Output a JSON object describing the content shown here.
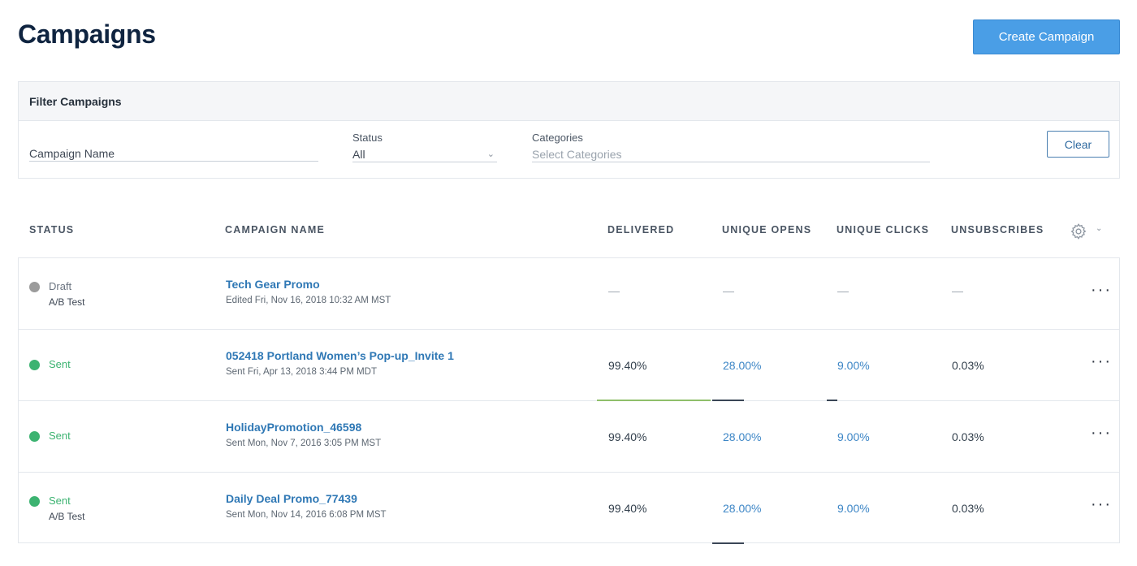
{
  "header": {
    "title": "Campaigns",
    "create_button": "Create Campaign"
  },
  "filters": {
    "title": "Filter Campaigns",
    "campaign_name_placeholder": "Campaign Name",
    "status_label": "Status",
    "status_value": "All",
    "categories_label": "Categories",
    "categories_placeholder": "Select Categories",
    "clear_button": "Clear"
  },
  "table": {
    "columns": [
      "STATUS",
      "CAMPAIGN NAME",
      "DELIVERED",
      "UNIQUE OPENS",
      "UNIQUE CLICKS",
      "UNSUBSCRIBES"
    ],
    "rows": [
      {
        "status": "Draft",
        "sub": "A/B Test",
        "name": "Tech Gear Promo",
        "meta": "Edited Fri, Nov 16, 2018 10:32 AM MST",
        "delivered": "—",
        "opens": "—",
        "clicks": "—",
        "unsubscribes": "—"
      },
      {
        "status": "Sent",
        "sub": "",
        "name": "052418 Portland Women’s Pop-up_Invite 1",
        "meta": "Sent Fri, Apr 13, 2018 3:44 PM MDT",
        "delivered": "99.40%",
        "opens": "28.00%",
        "clicks": "9.00%",
        "unsubscribes": "0.03%"
      },
      {
        "status": "Sent",
        "sub": "",
        "name": "HolidayPromotion_46598",
        "meta": "Sent Mon, Nov 7, 2016 3:05 PM MST",
        "delivered": "99.40%",
        "opens": "28.00%",
        "clicks": "9.00%",
        "unsubscribes": "0.03%"
      },
      {
        "status": "Sent",
        "sub": "A/B Test",
        "name": "Daily Deal Promo_77439",
        "meta": "Sent Mon, Nov 14, 2016 6:08 PM MST",
        "delivered": "99.40%",
        "opens": "28.00%",
        "clicks": "9.00%",
        "unsubscribes": "0.03%"
      }
    ],
    "row_actions": "···"
  },
  "colors": {
    "accent": "#4a9ee6",
    "draft": "#9b9b9b",
    "sent": "#3cb371",
    "link": "#2f78b5",
    "delivered_bar": "#8fbf6a",
    "opens_bar": "#3a4656"
  }
}
